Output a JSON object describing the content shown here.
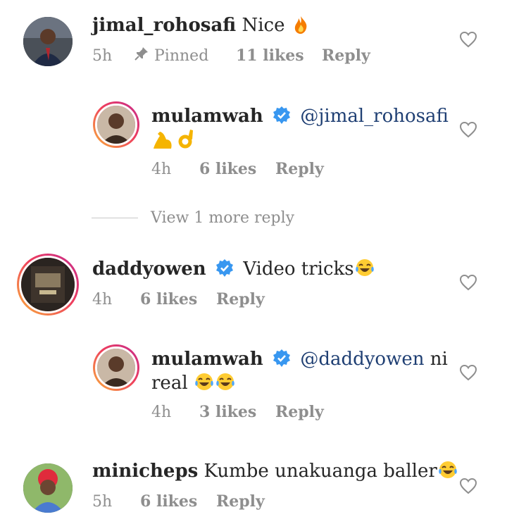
{
  "comments": [
    {
      "username": "jimal_rohosafi",
      "text": "Nice",
      "emoji": "fire",
      "time": "5h",
      "pinned_label": "Pinned",
      "likes": "11 likes",
      "reply": "Reply"
    },
    {
      "username": "mulamwah",
      "mention": "@jimal_rohosafi",
      "emoji": "flexed-biceps ok-hand",
      "time": "4h",
      "likes": "6 likes",
      "reply": "Reply"
    },
    {
      "username": "daddyowen",
      "text": "Video tricks",
      "emoji": "tears-of-joy",
      "time": "4h",
      "likes": "6 likes",
      "reply": "Reply"
    },
    {
      "username": "mulamwah",
      "mention": "@daddyowen",
      "text": "ni",
      "text2": "real",
      "emoji": "tears-of-joy tears-of-joy",
      "time": "4h",
      "likes": "3 likes",
      "reply": "Reply"
    },
    {
      "username": "minicheps",
      "text": "Kumbe unakuanga baller",
      "emoji": "tears-of-joy",
      "time": "5h",
      "likes": "6 likes",
      "reply": "Reply"
    }
  ],
  "view_more": "View 1 more reply",
  "colors": {
    "verified": "#3897f0",
    "mention": "#1f3f73",
    "meta": "#8e8e8e",
    "fire": "#f57c00",
    "story_ring": "#ee3e5e"
  },
  "icons": [
    "heart-icon",
    "pin-icon",
    "verified-badge-icon"
  ]
}
